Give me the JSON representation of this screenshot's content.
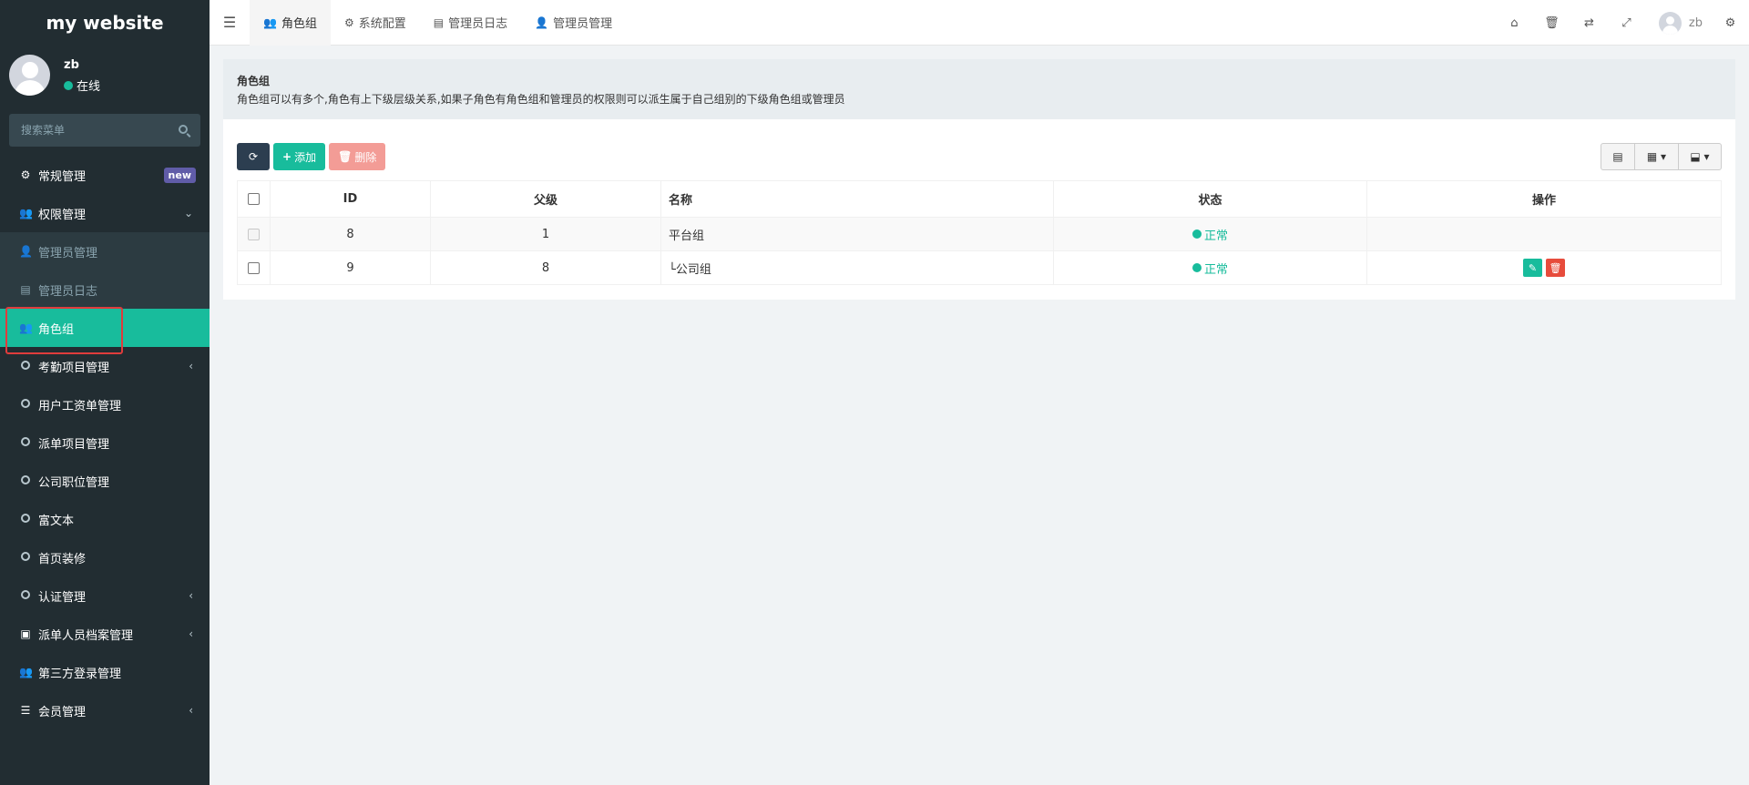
{
  "brand": "my website",
  "user": {
    "name": "zb",
    "status": "在线"
  },
  "search": {
    "placeholder": "搜索菜单"
  },
  "menu": {
    "items": [
      {
        "label": "常规管理",
        "badge": "new"
      },
      {
        "label": "权限管理"
      },
      {
        "label": "管理员管理"
      },
      {
        "label": "管理员日志"
      },
      {
        "label": "角色组"
      },
      {
        "label": "考勤项目管理"
      },
      {
        "label": "用户工资单管理"
      },
      {
        "label": "派单项目管理"
      },
      {
        "label": "公司职位管理"
      },
      {
        "label": "富文本"
      },
      {
        "label": "首页装修"
      },
      {
        "label": "认证管理"
      },
      {
        "label": "派单人员档案管理"
      },
      {
        "label": "第三方登录管理"
      },
      {
        "label": "会员管理"
      }
    ]
  },
  "topnav": {
    "tabs": [
      {
        "label": "角色组",
        "icon": "users-icon"
      },
      {
        "label": "系统配置",
        "icon": "gear-icon"
      },
      {
        "label": "管理员日志",
        "icon": "list-icon"
      },
      {
        "label": "管理员管理",
        "icon": "user-icon"
      }
    ],
    "username": "zb"
  },
  "panel": {
    "title": "角色组",
    "description": "角色组可以有多个,角色有上下级层级关系,如果子角色有角色组和管理员的权限则可以派生属于自己组别的下级角色组或管理员"
  },
  "toolbar": {
    "add_label": "添加",
    "delete_label": "删除"
  },
  "table": {
    "headers": [
      "ID",
      "父级",
      "名称",
      "状态",
      "操作"
    ],
    "rows": [
      {
        "id": "8",
        "parent": "1",
        "name": "平台组",
        "status": "正常"
      },
      {
        "id": "9",
        "parent": "8",
        "name": "└公司组",
        "status": "正常"
      }
    ]
  },
  "colors": {
    "accent": "#18bc9c",
    "sidebar": "#222d32",
    "danger": "#e74c3c"
  }
}
